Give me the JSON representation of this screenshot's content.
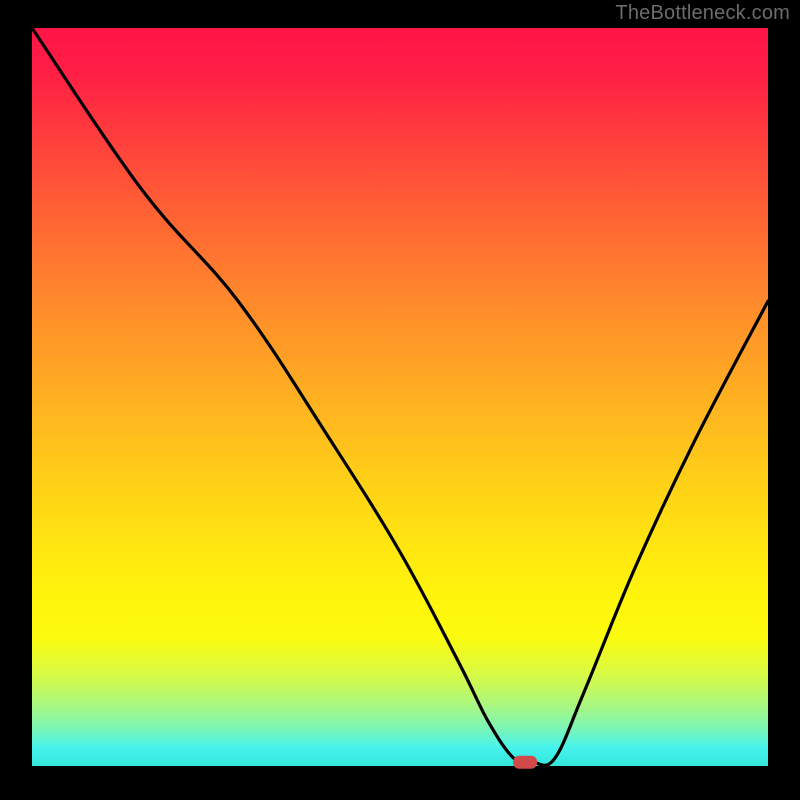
{
  "watermark": "TheBottleneck.com",
  "chart_data": {
    "type": "line",
    "title": "",
    "xlabel": "",
    "ylabel": "",
    "xlim": [
      0,
      100
    ],
    "ylim": [
      0,
      100
    ],
    "series": [
      {
        "name": "bottleneck-curve",
        "x": [
          0,
          15,
          28,
          40,
          50,
          58,
          62,
          65.5,
          68,
          71,
          75,
          82,
          90,
          100
        ],
        "values": [
          100,
          78,
          63,
          45,
          29,
          14,
          6,
          1,
          0.5,
          1,
          10,
          27,
          44,
          63
        ]
      }
    ],
    "marker": {
      "x": 67,
      "y": 0.5
    },
    "gradient_stops": [
      {
        "pct": 0,
        "color": "#ff1648"
      },
      {
        "pct": 36,
        "color": "#ff862c"
      },
      {
        "pct": 62,
        "color": "#ffd117"
      },
      {
        "pct": 82.5,
        "color": "#fcfb0e"
      },
      {
        "pct": 95,
        "color": "#7af5b8"
      },
      {
        "pct": 100,
        "color": "#32e7da"
      }
    ]
  }
}
